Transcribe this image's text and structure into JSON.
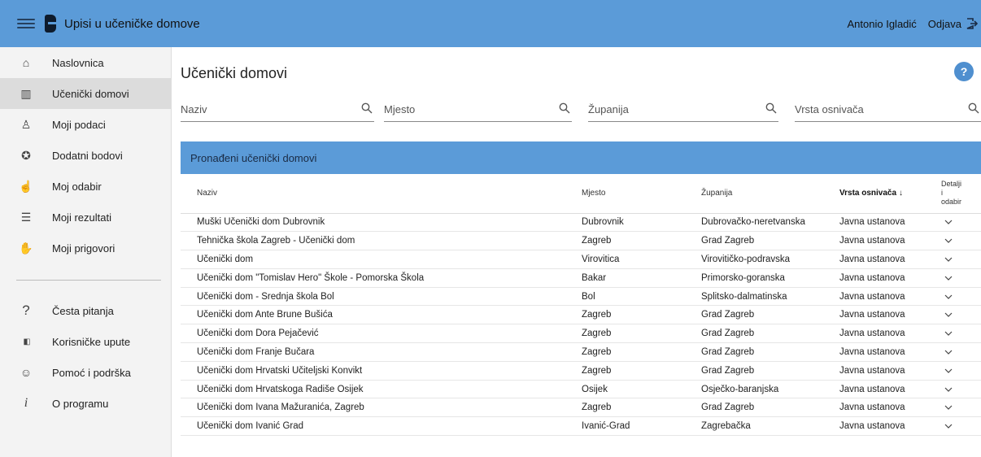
{
  "header": {
    "app_title": "Upisi u učeničke domove",
    "user_name": "Antonio Igladić",
    "logout_label": "Odjava"
  },
  "sidebar": {
    "items": [
      {
        "label": "Naslovnica",
        "icon": "home-icon",
        "glyph": "⌂",
        "active": false
      },
      {
        "label": "Učenički domovi",
        "icon": "building-icon",
        "glyph": "▥",
        "active": true
      },
      {
        "label": "Moji podaci",
        "icon": "person-icon",
        "glyph": "♙",
        "active": false
      },
      {
        "label": "Dodatni bodovi",
        "icon": "shield-star-icon",
        "glyph": "✪",
        "active": false
      },
      {
        "label": "Moj odabir",
        "icon": "pointing-hand-icon",
        "glyph": "☝",
        "active": false
      },
      {
        "label": "Moji rezultati",
        "icon": "list-icon",
        "glyph": "☰",
        "active": false
      },
      {
        "label": "Moji prigovori",
        "icon": "raised-hand-icon",
        "glyph": "✋",
        "active": false
      }
    ],
    "bottom_items": [
      {
        "label": "Česta pitanja",
        "icon": "question-icon",
        "glyph": "?"
      },
      {
        "label": "Korisničke upute",
        "icon": "book-icon",
        "glyph": "▮▯"
      },
      {
        "label": "Pomoć i podrška",
        "icon": "support-icon",
        "glyph": "☺"
      },
      {
        "label": "O programu",
        "icon": "info-icon",
        "glyph": "i"
      }
    ]
  },
  "main": {
    "page_title": "Učenički domovi",
    "help_label": "?",
    "filters": [
      {
        "placeholder": "Naziv"
      },
      {
        "placeholder": "Mjesto"
      },
      {
        "placeholder": "Županija"
      },
      {
        "placeholder": "Vrsta osnivača"
      }
    ],
    "panel_title": "Pronađeni učenički domovi",
    "columns": {
      "naziv": "Naziv",
      "mjesto": "Mjesto",
      "zupanija": "Županija",
      "vrsta": "Vrsta osnivača",
      "sort_arrow": "↓",
      "detalji_1": "Detalji",
      "detalji_2": "i",
      "detalji_3": "odabir"
    },
    "rows": [
      {
        "naziv": "Muški Učenički dom Dubrovnik",
        "mjesto": "Dubrovnik",
        "zupanija": "Dubrovačko-neretvanska",
        "vrsta": "Javna ustanova"
      },
      {
        "naziv": "Tehnička škola Zagreb - Učenički dom",
        "mjesto": "Zagreb",
        "zupanija": "Grad Zagreb",
        "vrsta": "Javna ustanova"
      },
      {
        "naziv": "Učenički dom",
        "mjesto": "Virovitica",
        "zupanija": "Virovitičko-podravska",
        "vrsta": "Javna ustanova"
      },
      {
        "naziv": "Učenički dom \"Tomislav Hero\" Škole - Pomorska Škola",
        "mjesto": "Bakar",
        "zupanija": "Primorsko-goranska",
        "vrsta": "Javna ustanova"
      },
      {
        "naziv": "Učenički dom - Srednja škola Bol",
        "mjesto": "Bol",
        "zupanija": "Splitsko-dalmatinska",
        "vrsta": "Javna ustanova"
      },
      {
        "naziv": "Učenički dom Ante Brune Bušića",
        "mjesto": "Zagreb",
        "zupanija": "Grad Zagreb",
        "vrsta": "Javna ustanova"
      },
      {
        "naziv": "Učenički dom Dora Pejačević",
        "mjesto": "Zagreb",
        "zupanija": "Grad Zagreb",
        "vrsta": "Javna ustanova"
      },
      {
        "naziv": "Učenički dom Franje Bučara",
        "mjesto": "Zagreb",
        "zupanija": "Grad Zagreb",
        "vrsta": "Javna ustanova"
      },
      {
        "naziv": "Učenički dom Hrvatski Učiteljski Konvikt",
        "mjesto": "Zagreb",
        "zupanija": "Grad Zagreb",
        "vrsta": "Javna ustanova"
      },
      {
        "naziv": "Učenički dom Hrvatskoga Radiše Osijek",
        "mjesto": "Osijek",
        "zupanija": "Osječko-baranjska",
        "vrsta": "Javna ustanova"
      },
      {
        "naziv": "Učenički dom Ivana Mažuranića, Zagreb",
        "mjesto": "Zagreb",
        "zupanija": "Grad Zagreb",
        "vrsta": "Javna ustanova"
      },
      {
        "naziv": "Učenički dom Ivanić Grad",
        "mjesto": "Ivanić-Grad",
        "zupanija": "Zagrebačka",
        "vrsta": "Javna ustanova"
      }
    ]
  }
}
